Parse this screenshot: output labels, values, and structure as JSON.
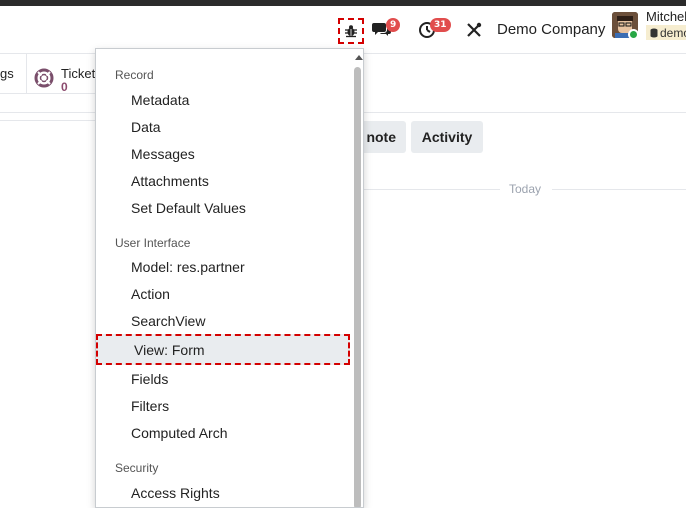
{
  "navbar": {
    "messages_badge": "9",
    "activities_badge": "31",
    "company": "Demo Company",
    "user_name": "Mitchell",
    "database": "demo"
  },
  "smartbuttons": {
    "partial_label": "gs",
    "tickets_label": "Ticket",
    "tickets_count": "0"
  },
  "chatter": {
    "note_label": "note",
    "activity_label": "Activity",
    "today_label": "Today"
  },
  "debug_menu": {
    "sections": [
      {
        "title": "Record",
        "items": [
          "Metadata",
          "Data",
          "Messages",
          "Attachments",
          "Set Default Values"
        ]
      },
      {
        "title": "User Interface",
        "items": [
          "Model: res.partner",
          "Action",
          "SearchView",
          "View: Form",
          "Fields",
          "Filters",
          "Computed Arch"
        ]
      },
      {
        "title": "Security",
        "items": [
          "Access Rights"
        ]
      }
    ],
    "highlighted_item": "View: Form"
  },
  "colors": {
    "accent_red": "#d40000",
    "badge_red": "#e14d4d",
    "ticket_count": "#8b4a6d"
  }
}
